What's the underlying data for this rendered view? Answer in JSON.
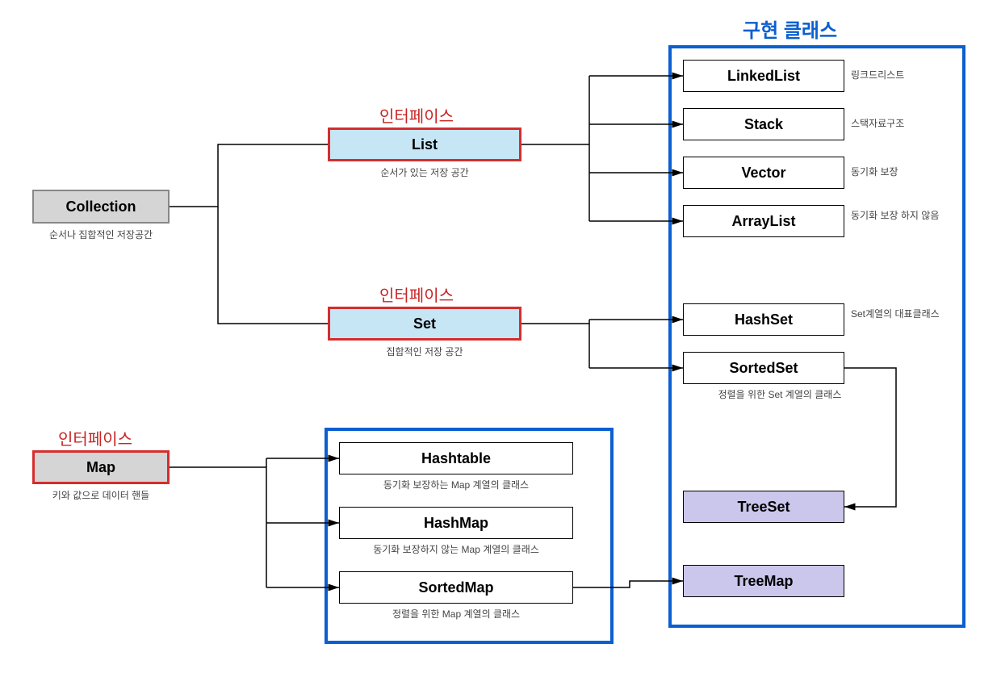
{
  "labels": {
    "interface": "인터페이스",
    "implClass": "구현 클래스"
  },
  "collection": {
    "name": "Collection",
    "caption": "순서나 집합적인 저장공간"
  },
  "list": {
    "name": "List",
    "caption": "순서가 있는 저장 공간"
  },
  "set": {
    "name": "Set",
    "caption": "집합적인 저장 공간"
  },
  "map": {
    "name": "Map",
    "caption": "키와 값으로 데이터 핸들"
  },
  "listImpl": [
    {
      "name": "LinkedList",
      "note": "링크드리스트"
    },
    {
      "name": "Stack",
      "note": "스택자료구조"
    },
    {
      "name": "Vector",
      "note": "동기화 보장"
    },
    {
      "name": "ArrayList",
      "note": "동기화 보장 하지 않음"
    }
  ],
  "setImpl": [
    {
      "name": "HashSet",
      "note": "Set계열의 대표클래스"
    },
    {
      "name": "SortedSet",
      "note": "정렬을 위한 Set 계열의 클래스"
    }
  ],
  "treeSet": {
    "name": "TreeSet"
  },
  "treeMap": {
    "name": "TreeMap"
  },
  "mapImpl": [
    {
      "name": "Hashtable",
      "note": "동기화 보장하는 Map 계열의 클래스"
    },
    {
      "name": "HashMap",
      "note": "동기화 보장하지 않는 Map 계열의 클래스"
    },
    {
      "name": "SortedMap",
      "note": "정렬을 위한 Map 계열의 클래스"
    }
  ]
}
